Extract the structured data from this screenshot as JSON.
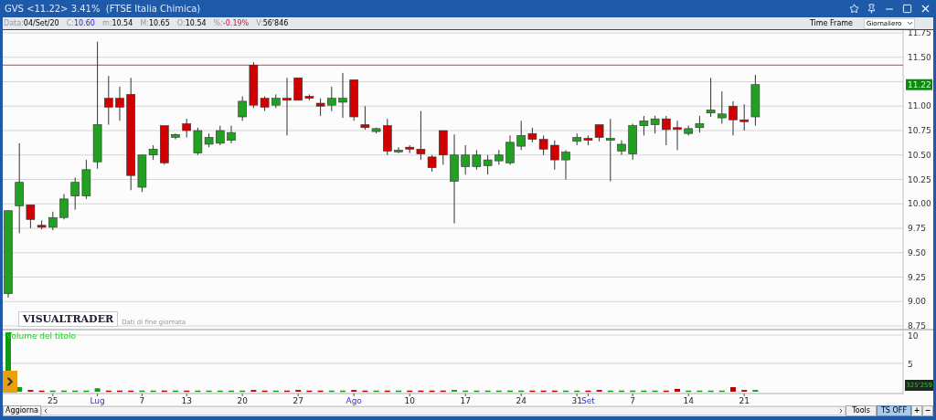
{
  "window": {
    "title": "GVS <11.22> 3.41%  (FTSE Italia Chimica)"
  },
  "info_bar": [
    {
      "label": "Data:",
      "value": "04/Set/20",
      "kind": "plain"
    },
    {
      "label": "C:",
      "value": "10.60",
      "kind": "close"
    },
    {
      "label": "m:",
      "value": "10.54",
      "kind": "plain"
    },
    {
      "label": "M:",
      "value": "10.65",
      "kind": "plain"
    },
    {
      "label": "O:",
      "value": "10.54",
      "kind": "plain"
    },
    {
      "label": "%:",
      "value": "-0.19%",
      "kind": "change"
    },
    {
      "label": "V:",
      "value": "56'846",
      "kind": "plain"
    }
  ],
  "time_frame": {
    "label": "Time Frame",
    "value": "Giornaliero"
  },
  "price_chart": {
    "logo": "VISUALTRADER",
    "note": "Dati di fine giornata",
    "last_price": "11.22",
    "axis_labels": [
      "11.75",
      "11.50",
      "11.00",
      "10.75",
      "10.50",
      "10.25",
      "10.00",
      "9.75",
      "9.50",
      "9.25",
      "9.00",
      "8.75"
    ]
  },
  "volume_chart": {
    "title": "Volume del titolo",
    "total": "325'259",
    "axis_labels": [
      "10",
      "5"
    ]
  },
  "date_labels": [
    {
      "label": "25",
      "kind": "day"
    },
    {
      "label": "Lug",
      "kind": "month"
    },
    {
      "label": "7",
      "kind": "day"
    },
    {
      "label": "13",
      "kind": "day"
    },
    {
      "label": "20",
      "kind": "day"
    },
    {
      "label": "27",
      "kind": "day"
    },
    {
      "label": "Ago",
      "kind": "month"
    },
    {
      "label": "10",
      "kind": "day"
    },
    {
      "label": "17",
      "kind": "day"
    },
    {
      "label": "24",
      "kind": "day"
    },
    {
      "label": "31",
      "kind": "day"
    },
    {
      "label": "Set",
      "kind": "month"
    },
    {
      "label": "7",
      "kind": "day"
    },
    {
      "label": "14",
      "kind": "day"
    },
    {
      "label": "21",
      "kind": "day"
    }
  ],
  "bottom_bar": {
    "refresh": "Aggiorna",
    "tools": "Tools",
    "ts": {
      "label": "TS OFF",
      "selected": true
    },
    "zoom_in": "+",
    "zoom_out": "−"
  }
}
